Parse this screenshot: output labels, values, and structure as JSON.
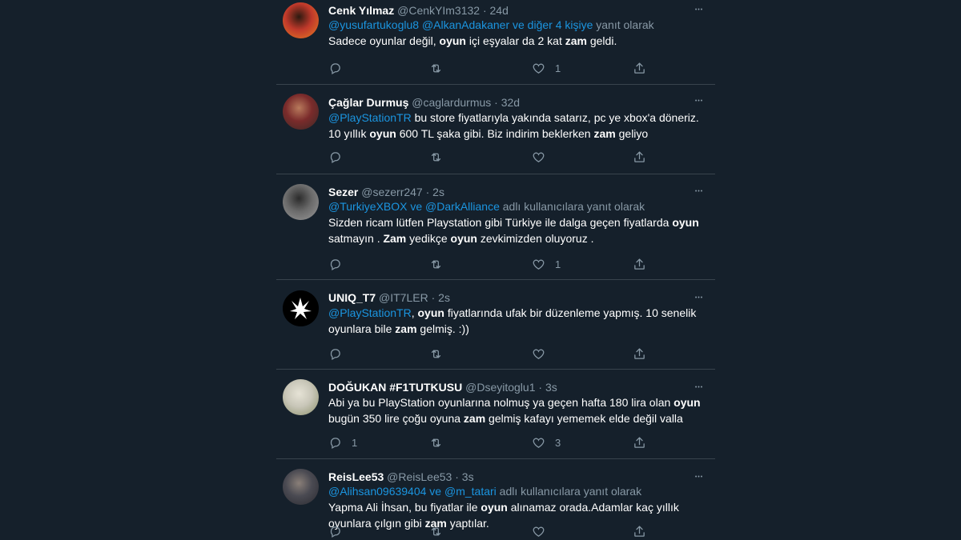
{
  "tweets": [
    {
      "name": "Cenk Yılmaz",
      "handle": "@CenkYIm3132",
      "time": "24d",
      "replying": {
        "mentions": "@yusufartukoglu8 @AlkanAdakaner  ve diğer 4 kişiye",
        "suffix": " yanıt olarak"
      },
      "text": [
        {
          "t": "Sadece oyunlar değil, ",
          "b": false
        },
        {
          "t": "oyun",
          "b": true
        },
        {
          "t": " içi eşyalar da 2 kat ",
          "b": false
        },
        {
          "t": "zam",
          "b": true
        },
        {
          "t": " geldi.",
          "b": false
        }
      ],
      "counts": {
        "reply": "",
        "retweet": "",
        "like": "1"
      },
      "avatar_colors": [
        "#c0392b",
        "#e67e22",
        "#2c1a10"
      ]
    },
    {
      "name": "Çağlar Durmuş",
      "handle": "@caglardurmus",
      "time": "32d",
      "replying": null,
      "text": [
        {
          "t": "@PlayStationTR",
          "b": false,
          "link": true
        },
        {
          "t": " bu store fiyatlarıyla yakında satarız, pc ye xbox'a döneriz. 10 yıllık ",
          "b": false
        },
        {
          "t": "oyun",
          "b": true
        },
        {
          "t": " 600 TL şaka gibi. Biz indirim beklerken ",
          "b": false
        },
        {
          "t": "zam",
          "b": true
        },
        {
          "t": " geliyo",
          "b": false
        }
      ],
      "counts": {
        "reply": "",
        "retweet": "",
        "like": ""
      },
      "avatar_colors": [
        "#7a2b2b",
        "#3a2a26",
        "#b87a5c"
      ]
    },
    {
      "name": "Sezer",
      "handle": "@sezerr247",
      "time": "2s",
      "replying": {
        "mentions": "@TurkiyeXBOX ve @DarkAlliance",
        "suffix": " adlı kullanıcılara yanıt olarak"
      },
      "text": [
        {
          "t": "Sizden ricam lütfen Playstation gibi Türkiye ile dalga geçen fiyatlarda ",
          "b": false
        },
        {
          "t": "oyun",
          "b": true
        },
        {
          "t": " satmayın . ",
          "b": false
        },
        {
          "t": "Zam",
          "b": true
        },
        {
          "t": " yedikçe ",
          "b": false
        },
        {
          "t": "oyun",
          "b": true
        },
        {
          "t": " zevkimizden oluyoruz .",
          "b": false
        }
      ],
      "counts": {
        "reply": "",
        "retweet": "",
        "like": "1"
      },
      "avatar_colors": [
        "#6b6b6b",
        "#9a9a9a",
        "#2b2b2b"
      ]
    },
    {
      "name": "UNIQ_T7",
      "handle": "@IT7LER",
      "time": "2s",
      "replying": null,
      "text": [
        {
          "t": "@PlayStationTR",
          "b": false,
          "link": true
        },
        {
          "t": ", ",
          "b": false
        },
        {
          "t": "oyun",
          "b": true
        },
        {
          "t": " fiyatlarında ufak bir düzenleme yapmış. 10 senelik oyunlara bile ",
          "b": false
        },
        {
          "t": "zam",
          "b": true
        },
        {
          "t": " gelmiş. :))",
          "b": false
        }
      ],
      "counts": {
        "reply": "",
        "retweet": "",
        "like": ""
      },
      "avatar_colors": [
        "#000000",
        "#ffffff",
        "#1a1a1a"
      ]
    },
    {
      "name": "DOĞUKAN #F1TUTKUSU",
      "handle": "@Dseyitoglu1",
      "time": "3s",
      "replying": null,
      "text": [
        {
          "t": "Abi ya bu PlayStation oyunlarına nolmuş ya geçen hafta 180 lira olan ",
          "b": false
        },
        {
          "t": "oyun",
          "b": true
        },
        {
          "t": " bugün 350 lire çoğu oyuna ",
          "b": false
        },
        {
          "t": "zam",
          "b": true
        },
        {
          "t": " gelmiş kafayı yememek elde değil valla",
          "b": false
        }
      ],
      "counts": {
        "reply": "1",
        "retweet": "",
        "like": "3"
      },
      "avatar_colors": [
        "#c8c6b8",
        "#8a8f6a",
        "#e6e3d6"
      ]
    },
    {
      "name": "ReisLee53",
      "handle": "@ReisLee53",
      "time": "3s",
      "replying": {
        "mentions": "@Alihsan09639404 ve @m_tatari",
        "suffix": " adlı kullanıcılara yanıt olarak"
      },
      "text": [
        {
          "t": "Yapma Ali İhsan, bu fiyatlar ile ",
          "b": false
        },
        {
          "t": "oyun",
          "b": true
        },
        {
          "t": " alınamaz orada.Adamlar kaç yıllık oyunlara çılgın gibi ",
          "b": false
        },
        {
          "t": "zam",
          "b": true
        },
        {
          "t": " yaptılar.",
          "b": false
        }
      ],
      "counts": {
        "reply": "",
        "retweet": "",
        "like": ""
      },
      "avatar_colors": [
        "#4a4a52",
        "#2a2a30",
        "#8a7f78"
      ]
    }
  ],
  "colors": {
    "background": "#15202b",
    "divider": "#38444d",
    "link": "#1b95e0",
    "muted": "#8899a6"
  },
  "icons": {
    "reply": "reply-icon",
    "retweet": "retweet-icon",
    "like": "like-icon",
    "share": "share-icon",
    "more": "more-options-icon"
  }
}
